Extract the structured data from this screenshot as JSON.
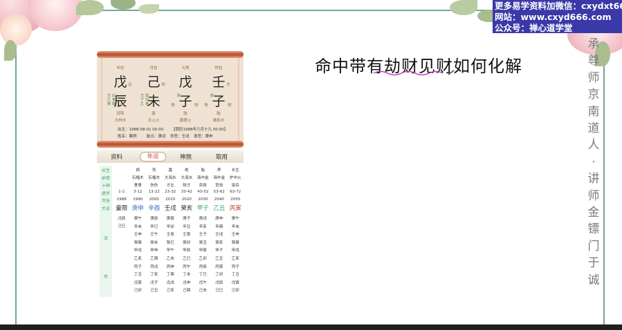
{
  "watermark": {
    "line1": "更多易学资料加微信：cxydxt66",
    "line2": "网站：www.cxyd666.com",
    "line3": "公众号：禅心道学堂"
  },
  "title": "命中带有劫财见财如何化解",
  "vertical_text": [
    "承",
    "尊",
    "师",
    "京",
    "南",
    "道",
    "人",
    "·",
    "讲",
    "师",
    "金",
    "镖",
    "门",
    "于",
    "诚"
  ],
  "colors": {
    "frame": "#6fa79b",
    "watermark_bg": "#3b38a8",
    "accent_green": "#3aa55a",
    "tab_active": "#c04a2a"
  },
  "chart": {
    "pillar_headers": [
      "年柱",
      "月柱",
      "元男",
      "时柱"
    ],
    "stems": [
      "戊",
      "己",
      "戊",
      "壬"
    ],
    "stem_gods": [
      "比",
      "劫",
      "",
      "才"
    ],
    "branches": [
      "辰",
      "未",
      "子",
      "子"
    ],
    "branch_side": [
      {
        "left": "戊乙癸",
        "right": "比官财"
      },
      {
        "left": "己丁乙",
        "right": "劫印官"
      },
      {
        "left": "",
        "right": "财"
      },
      {
        "left": "",
        "right": "财"
      }
    ],
    "branch_tags": [
      [
        "",
        ""
      ],
      [
        "",
        ""
      ],
      [
        "癸",
        "财"
      ],
      [
        "癸",
        "财"
      ]
    ],
    "life_stage": [
      "冠带",
      "衰",
      "胎",
      "胎"
    ],
    "nayin": [
      "大林木",
      "天上火",
      "霹雳火",
      "桑柘木"
    ],
    "birth": "出生：1988-08-01 00:00",
    "lunar": "【阴历1988年六月十九 00:00】",
    "name_line": [
      "姓名：案例",
      "胎元：庚戌",
      "命宫：壬戌",
      "身宫：庚申"
    ]
  },
  "tabs": {
    "left": "资料",
    "active": "年运",
    "mid": "神煞",
    "right": "取用"
  },
  "grid": {
    "row_labels": [
      "长生",
      "纳音",
      "十神",
      "虚岁",
      "年份",
      "大运",
      "流",
      "年"
    ],
    "cols": [
      {
        "changsheng": "",
        "nayin": "",
        "shishen": "",
        "xusui": "1-2",
        "year": "1988",
        "dayun": "童限",
        "flow": [
          "戊辰",
          "己巳"
        ]
      },
      {
        "changsheng": "病",
        "nayin": "石榴木",
        "shishen": "食食",
        "xusui": "3-12",
        "year": "1990",
        "dayun": "庚申",
        "flow": [
          "庚午",
          "辛未",
          "壬申",
          "癸酉",
          "甲戌",
          "乙亥",
          "丙子",
          "丁丑",
          "戊寅",
          "己卯"
        ]
      },
      {
        "changsheng": "死",
        "nayin": "石榴木",
        "shishen": "伤伤",
        "xusui": "13-22",
        "year": "2000",
        "dayun": "辛酉",
        "flow": [
          "庚辰",
          "辛巳",
          "壬午",
          "癸未",
          "甲申",
          "乙酉",
          "丙戌",
          "丁亥",
          "戊子",
          "己丑"
        ]
      },
      {
        "changsheng": "墓",
        "nayin": "大海水",
        "shishen": "才比",
        "xusui": "23-32",
        "year": "2010",
        "dayun": "壬戌",
        "flow": [
          "庚寅",
          "辛卯",
          "壬辰",
          "癸巳",
          "甲午",
          "乙未",
          "丙申",
          "丁酉",
          "戊戌",
          "己亥"
        ]
      },
      {
        "changsheng": "绝",
        "nayin": "大海水",
        "shishen": "财才",
        "xusui": "33-42",
        "year": "2020",
        "dayun": "癸亥",
        "flow": [
          "庚子",
          "辛丑",
          "壬寅",
          "癸卯",
          "甲辰",
          "乙巳",
          "丙午",
          "丁未",
          "戊申",
          "己酉"
        ]
      },
      {
        "changsheng": "胎",
        "nayin": "海中金",
        "shishen": "杀财",
        "xusui": "43-52",
        "year": "2030",
        "dayun": "甲子",
        "flow": [
          "庚戌",
          "辛亥",
          "壬子",
          "癸丑",
          "甲寅",
          "乙卯",
          "丙辰",
          "丁巳",
          "戊午",
          "己未"
        ]
      },
      {
        "changsheng": "养",
        "nayin": "海中金",
        "shishen": "官劫",
        "xusui": "53-62",
        "year": "2040",
        "dayun": "乙丑",
        "flow": [
          "庚申",
          "辛酉",
          "壬戌",
          "癸亥",
          "甲子",
          "乙丑",
          "丙寅",
          "丁卯",
          "戊辰",
          "己巳"
        ]
      },
      {
        "changsheng": "长生",
        "nayin": "炉中火",
        "shishen": "枭杀",
        "xusui": "63-72",
        "year": "2050",
        "dayun": "丙寅",
        "flow": [
          "庚午",
          "辛未",
          "壬申",
          "癸酉",
          "甲戌",
          "乙亥",
          "丙子",
          "丁丑",
          "戊寅",
          "己卯"
        ]
      }
    ]
  }
}
